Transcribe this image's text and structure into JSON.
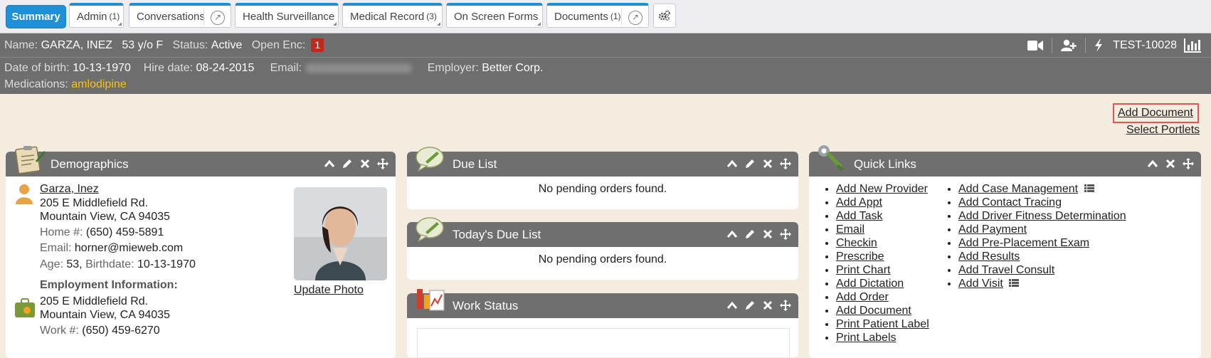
{
  "tabs": [
    {
      "label": "Summary",
      "count": ""
    },
    {
      "label": "Admin",
      "count": "(1)"
    },
    {
      "label": "Conversations",
      "count": ""
    },
    {
      "label": "Health Surveillance",
      "count": ""
    },
    {
      "label": "Medical Record",
      "count": "(3)"
    },
    {
      "label": "On Screen Forms",
      "count": ""
    },
    {
      "label": "Documents",
      "count": "(1)"
    }
  ],
  "banner": {
    "name_label": "Name:",
    "name": "GARZA, INEZ",
    "age_sex": "53 y/o F",
    "status_label": "Status:",
    "status": "Active",
    "open_enc_label": "Open Enc:",
    "open_enc": "1",
    "account": "TEST-10028",
    "dob_label": "Date of birth:",
    "dob": "10-13-1970",
    "hire_label": "Hire date:",
    "hire": "08-24-2015",
    "email_label": "Email:",
    "employer_label": "Employer:",
    "employer": "Better Corp.",
    "meds_label": "Medications:",
    "meds": "amlodipine"
  },
  "links": {
    "add_document": "Add Document",
    "select_portlets": "Select Portlets"
  },
  "demographics": {
    "title": "Demographics",
    "patient_name": "Garza, Inez",
    "addr1": "205 E Middlefield Rd.",
    "addr2": "Mountain View, CA 94035",
    "home_label": "Home #:",
    "home": "(650) 459-5891",
    "email_label": "Email:",
    "email": "horner@mieweb.com",
    "age_label": "Age:",
    "age": "53,",
    "birth_label": "Birthdate:",
    "birth": "10-13-1970",
    "update_photo": "Update Photo",
    "emp_title": "Employment Information:",
    "emp_addr1": "205 E Middlefield Rd.",
    "emp_addr2": "Mountain View, CA 94035",
    "work_label": "Work #:",
    "work": "(650) 459-6270"
  },
  "due_list": {
    "title": "Due List",
    "message": "No pending orders found."
  },
  "todays_due": {
    "title": "Today's Due List",
    "message": "No pending orders found."
  },
  "work_status": {
    "title": "Work Status"
  },
  "quick_links": {
    "title": "Quick Links",
    "col1": [
      "Add New Provider",
      "Add Appt",
      "Add Task",
      "Email",
      "Checkin",
      "Prescribe",
      "Print Chart",
      "Add Dictation",
      "Add Order",
      "Add Document",
      "Print Patient Label",
      "Print Labels"
    ],
    "col2": [
      "Add Case Management",
      "Add Contact Tracing",
      "Add Driver Fitness Determination",
      "Add Payment",
      "Add Pre-Placement Exam",
      "Add Results",
      "Add Travel Consult",
      "Add Visit"
    ]
  },
  "colors": {
    "accent": "#1f8fd6",
    "banner": "#6e6e6e",
    "medication": "#f6c21a",
    "badge": "#c0281b",
    "background": "#f3ecdf"
  }
}
